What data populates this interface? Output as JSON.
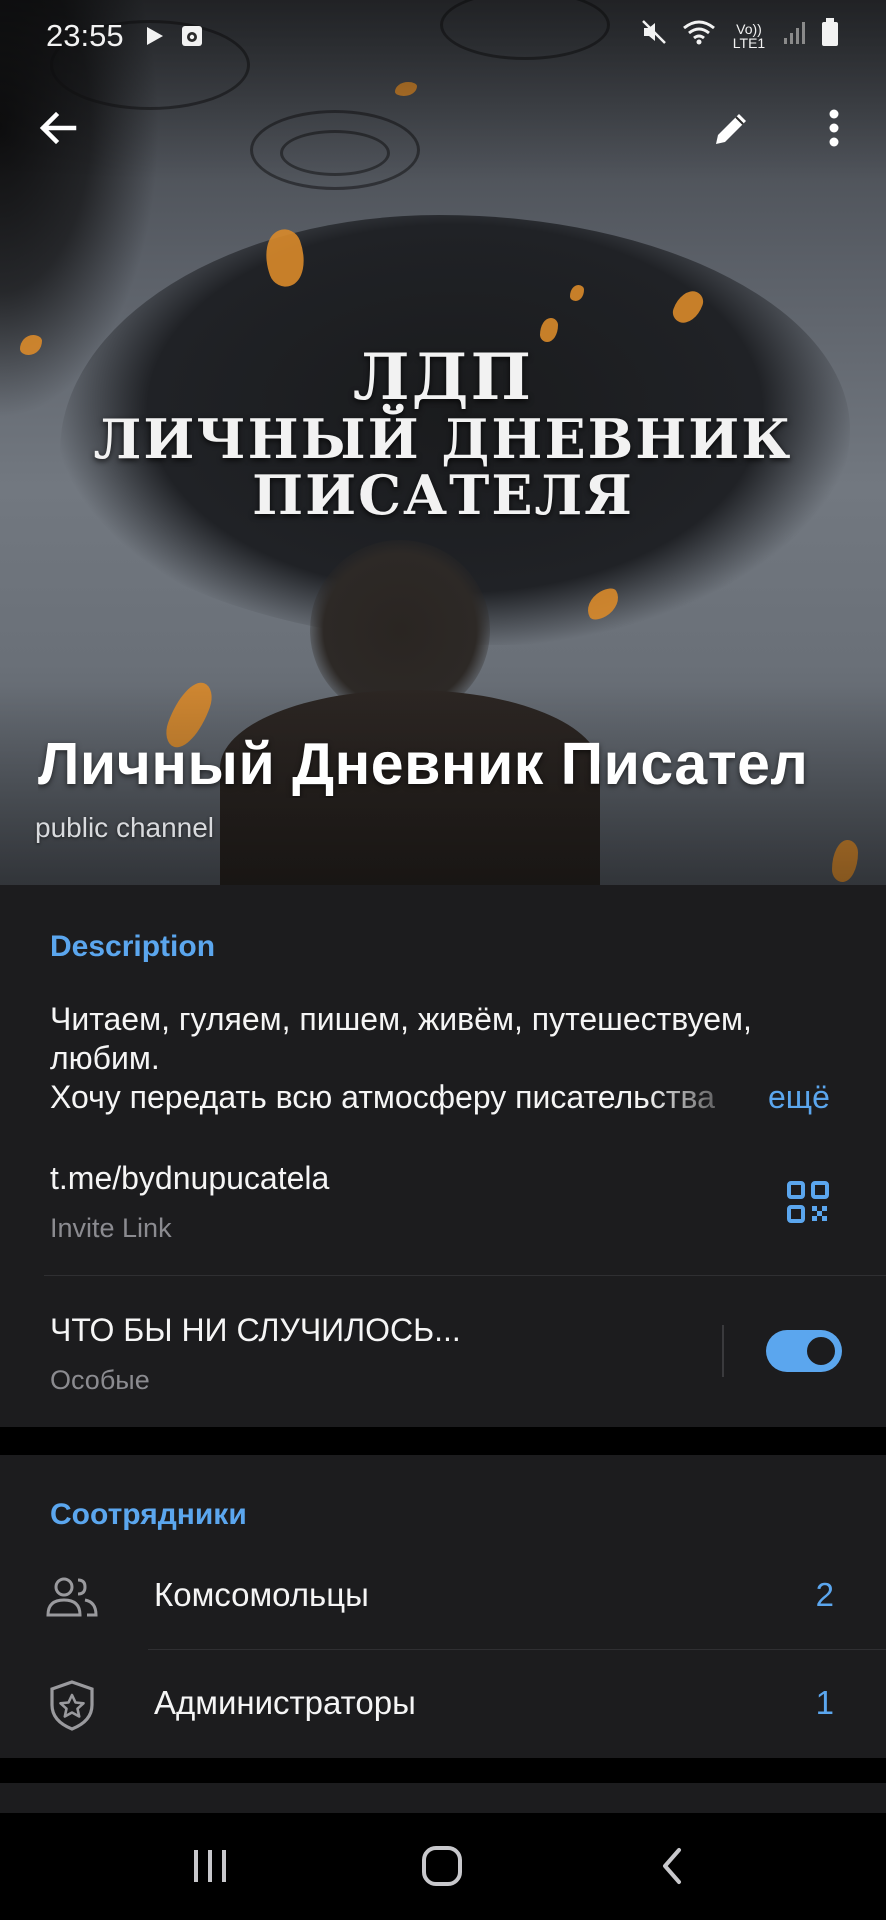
{
  "status_bar": {
    "time": "23:55",
    "icons_left": [
      "play-icon",
      "record-icon"
    ],
    "icons_right": [
      "mute-icon",
      "wifi-icon",
      "volte-icon",
      "signal-icon",
      "battery-icon"
    ],
    "volte_label": "Vo)) LTE1"
  },
  "toolbar": {
    "back_icon": "arrow-left-icon",
    "edit_icon": "pencil-icon",
    "more_icon": "more-vertical-icon"
  },
  "cover": {
    "title_line1": "ЛДП",
    "title_line2": "ЛИЧНЫЙ ДНЕВНИК",
    "title_line3": "ПИСАТЕЛЯ"
  },
  "channel": {
    "name": "Личный Дневник Писател",
    "type": "public channel"
  },
  "info": {
    "description_title": "Description",
    "description_line1": "Читаем, гуляем, пишем, живём, путешествуем,",
    "description_line2": "любим.",
    "description_line3": "Хочу передать всю атмосферу писательства",
    "more_label": "ещё",
    "link": "t.me/bydnupucatela",
    "link_caption": "Invite Link",
    "notification_title": "ЧТО БЫ НИ СЛУЧИЛОСЬ...",
    "notification_caption": "Особые",
    "notification_enabled": true
  },
  "staff": {
    "title": "Соотрядники",
    "rows": [
      {
        "label": "Комсомольцы",
        "count": "2",
        "icon": "users-icon"
      },
      {
        "label": "Администраторы",
        "count": "1",
        "icon": "shield-star-icon"
      }
    ]
  },
  "nav": {
    "recents_icon": "recents-icon",
    "home_icon": "home-icon",
    "back_icon": "nav-back-icon"
  },
  "colors": {
    "accent": "#5ba6ee",
    "surface": "#1c1c1e",
    "background": "#000000",
    "subtext": "#8b8b90"
  }
}
